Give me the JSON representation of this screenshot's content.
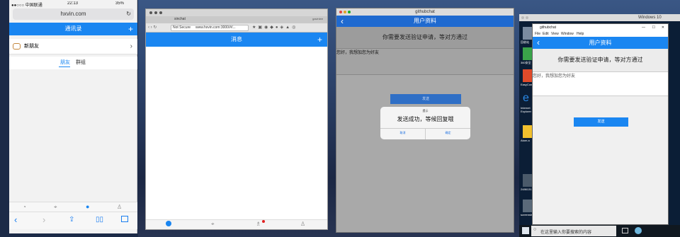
{
  "iphone": {
    "carrier": "●●○○○ 中国联通",
    "time": "22:13",
    "battery": "35%",
    "url": "hxvin.com",
    "header_title": "通讯录",
    "new_friend_label": "新朋友",
    "tab_friends": "朋友",
    "tab_groups": "群组"
  },
  "mac_browser": {
    "tab_title": "sinchat",
    "user_label": "gavinlee",
    "not_secure": "Not Secure",
    "address": "www.hxvin.com:3000/#/...",
    "header_title": "消息"
  },
  "githubchat_mac": {
    "window_title": "githubchat",
    "header_title": "用户资料",
    "request_text": "你需要发送验证申请，等对方通过",
    "message_text": "您好，我想加您为好友",
    "send_button": "发送",
    "dialog_title": "提示",
    "dialog_message": "发送成功，等候回复哦",
    "dialog_cancel": "取消",
    "dialog_ok": "确定"
  },
  "windows": {
    "os_title": "Windows 10",
    "window_title": "githubchat",
    "menu": [
      "File",
      "Edit",
      "View",
      "Window",
      "Help"
    ],
    "header_title": "用户资料",
    "request_text": "你需要发送验证申请，等对方通过",
    "message_text": "您好，我想加您为好友",
    "send_button": "发送",
    "desktop_icons": [
      "回收站",
      "360安全",
      "EasyConn",
      "Internet Explorer",
      "Atom.a",
      "2486131",
      "screenshot"
    ],
    "search_placeholder": "在这里输入你要搜索的内容"
  }
}
